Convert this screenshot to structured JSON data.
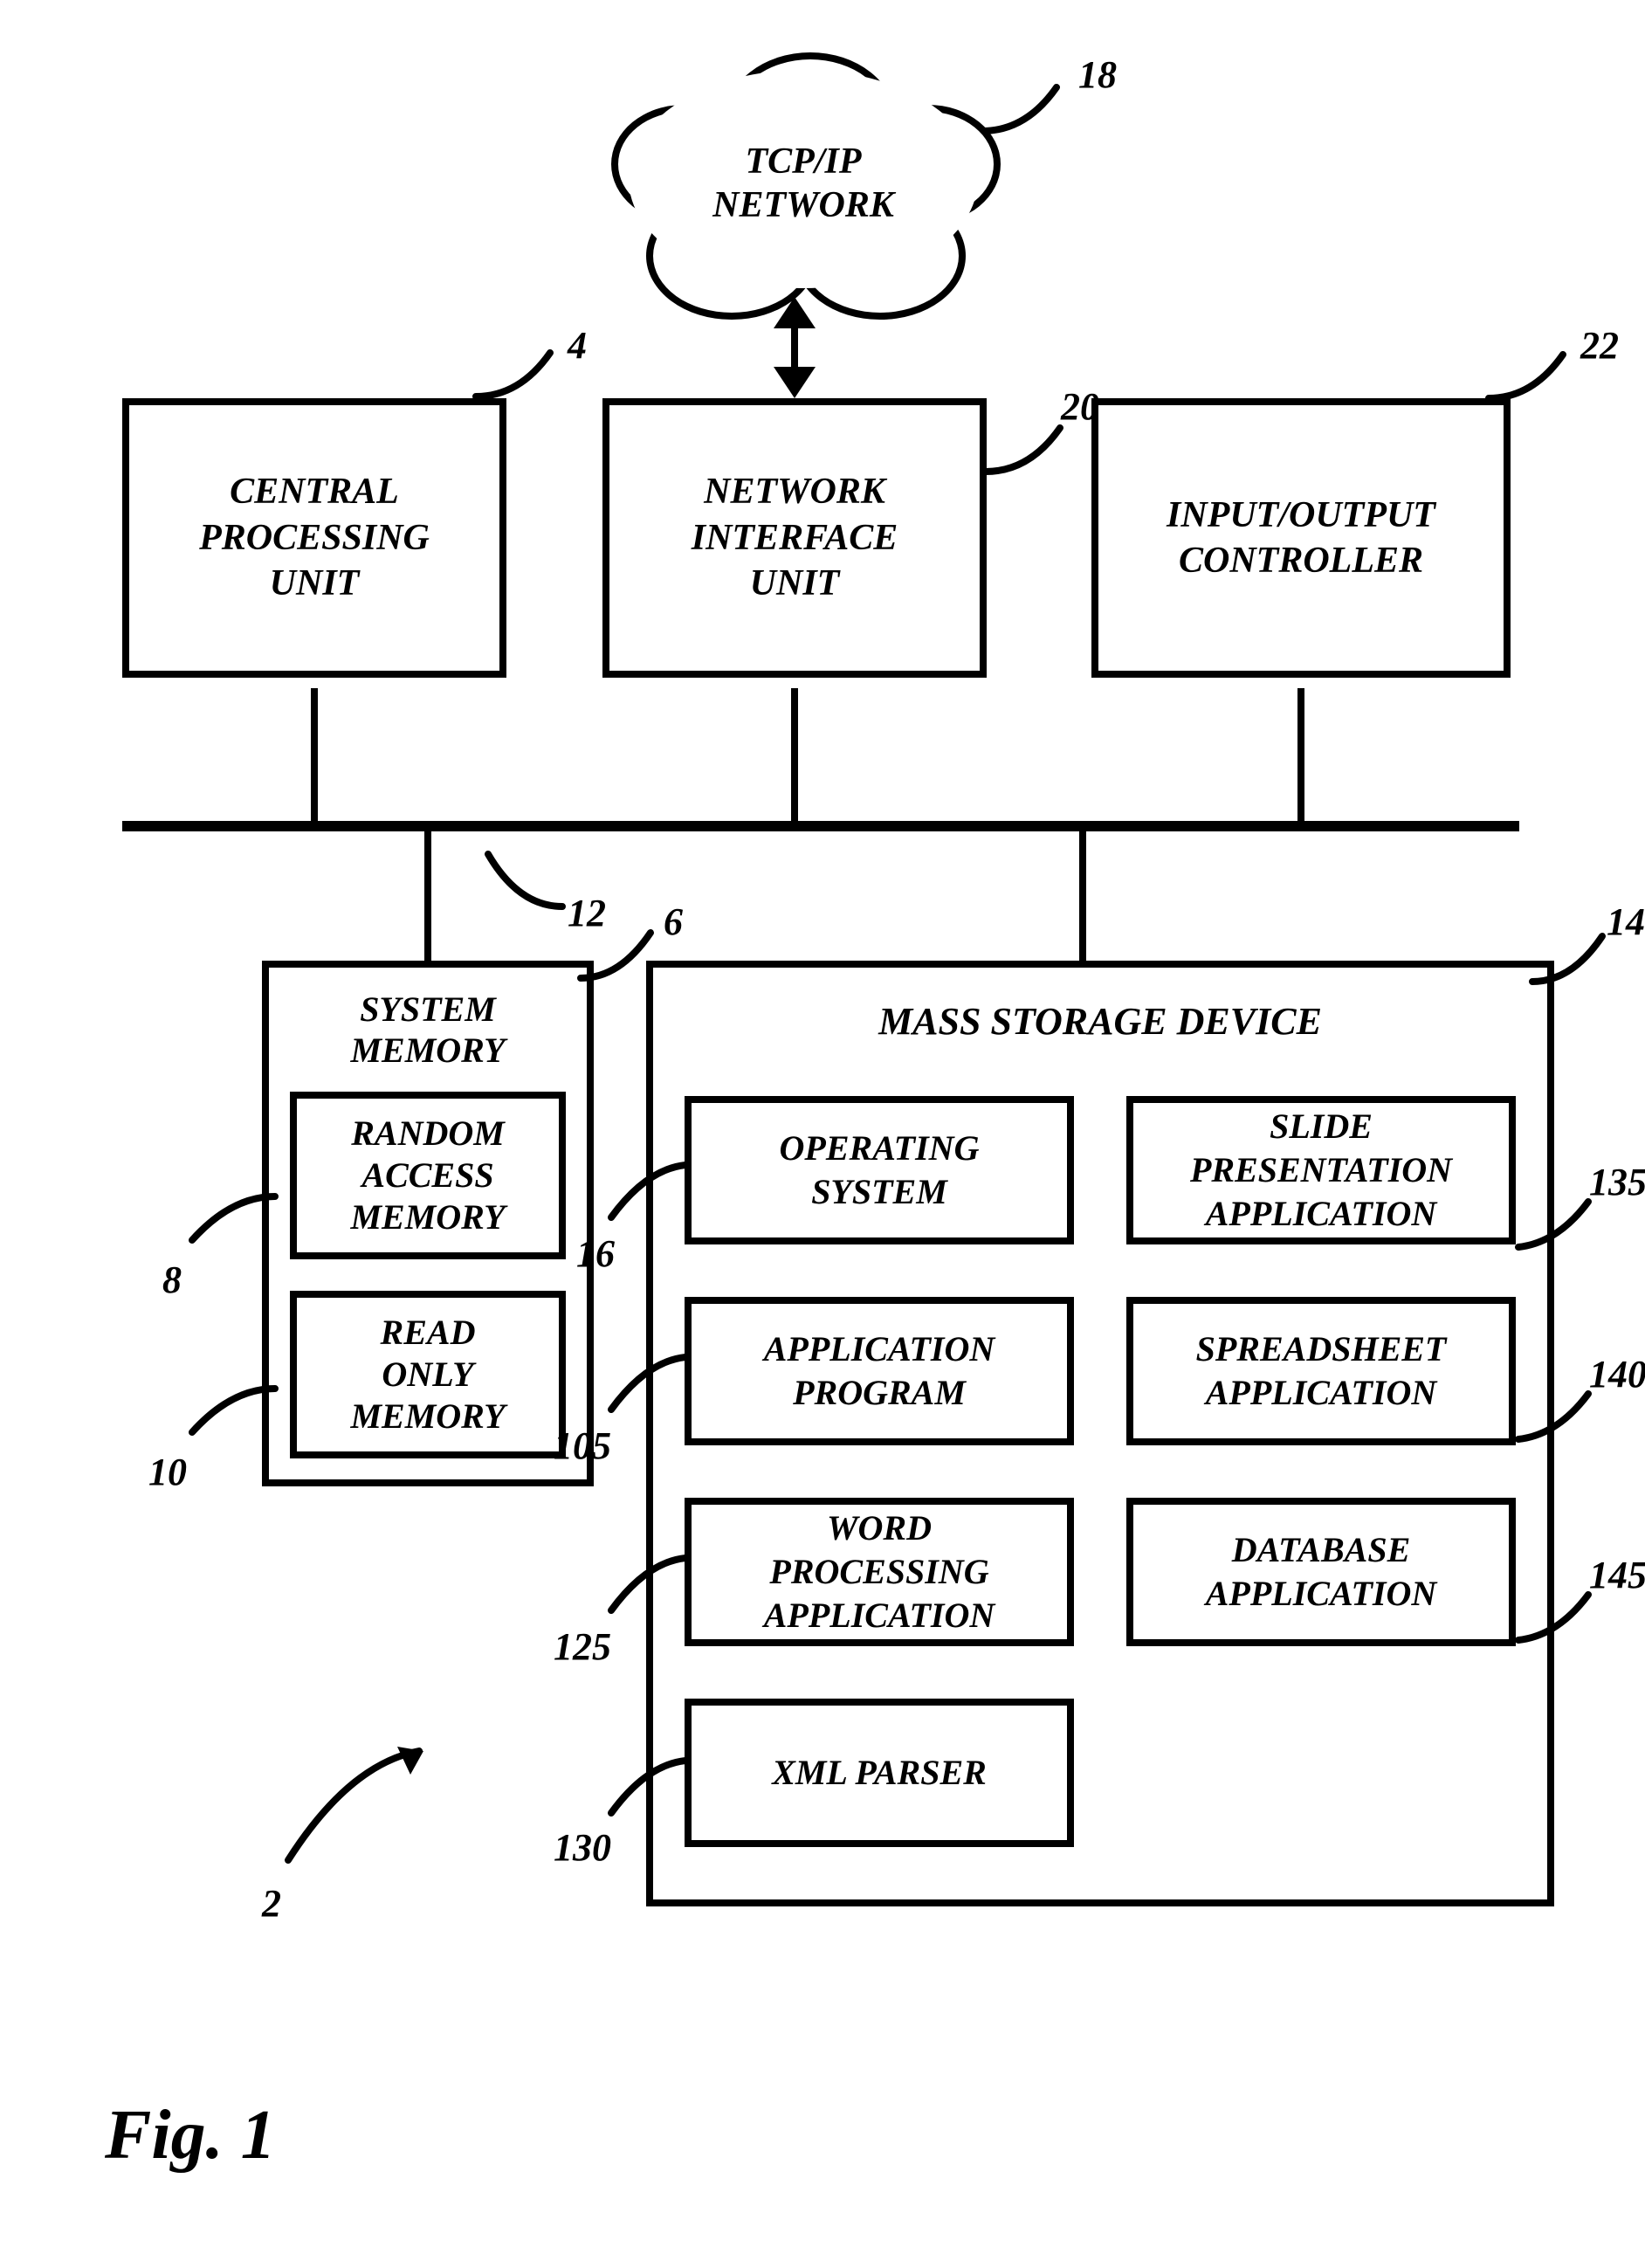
{
  "figure_label": "Fig. 1",
  "blocks": {
    "cpu": [
      "CENTRAL",
      "PROCESSING",
      "UNIT"
    ],
    "niu": [
      "NETWORK",
      "INTERFACE",
      "UNIT"
    ],
    "ioc": [
      "INPUT/OUTPUT",
      "CONTROLLER"
    ],
    "cloud": [
      "TCP/IP",
      "NETWORK"
    ]
  },
  "system_memory": {
    "title": "SYSTEM MEMORY",
    "ram": [
      "RANDOM",
      "ACCESS",
      "MEMORY"
    ],
    "rom": [
      "READ",
      "ONLY",
      "MEMORY"
    ]
  },
  "mass_storage": {
    "title": "MASS STORAGE DEVICE",
    "cells": {
      "os": [
        "OPERATING",
        "SYSTEM"
      ],
      "slide": [
        "SLIDE",
        "PRESENTATION",
        "APPLICATION"
      ],
      "app": [
        "APPLICATION",
        "PROGRAM"
      ],
      "spread": [
        "SPREADSHEET",
        "APPLICATION"
      ],
      "word": [
        "WORD",
        "PROCESSING",
        "APPLICATION"
      ],
      "db": [
        "DATABASE",
        "APPLICATION"
      ],
      "xml": [
        "XML PARSER"
      ]
    }
  },
  "refs": {
    "2": "2",
    "4": "4",
    "6": "6",
    "8": "8",
    "10": "10",
    "12": "12",
    "14": "14",
    "16": "16",
    "18": "18",
    "20": "20",
    "22": "22",
    "105": "105",
    "125": "125",
    "130": "130",
    "135": "135",
    "140": "140",
    "145": "145"
  },
  "diagram_description": "Block diagram of a computer system architecture. A horizontal system bus (12) connects a Central Processing Unit (4), a Network Interface Unit (20) linked via double-arrow to a TCP/IP Network cloud (18), and an Input/Output Controller (22) on the top row. Below the bus: System Memory (6) containing Random Access Memory (8) and Read Only Memory (10); and Mass Storage Device (14) containing Operating System (16), Slide Presentation Application (135), Application Program (105), Spreadsheet Application (140), Word Processing Application (125), Database Application (145), XML Parser (130). The overall system is labeled (2)."
}
